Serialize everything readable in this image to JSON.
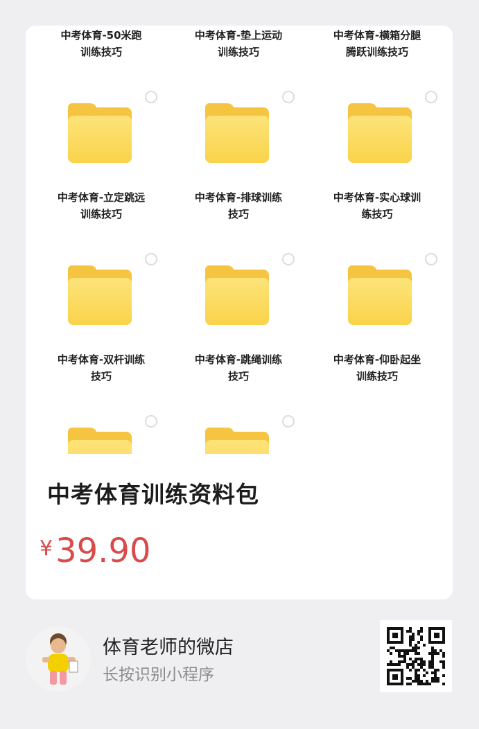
{
  "folders": [
    {
      "label_line1": "中考体育-50米跑",
      "label_line2": "训练技巧"
    },
    {
      "label_line1": "中考体育-垫上运动",
      "label_line2": "训练技巧"
    },
    {
      "label_line1": "中考体育-横箱分腿",
      "label_line2": "腾跃训练技巧"
    },
    {
      "label_line1": "中考体育-立定跳远",
      "label_line2": "训练技巧"
    },
    {
      "label_line1": "中考体育-排球训练",
      "label_line2": "技巧"
    },
    {
      "label_line1": "中考体育-实心球训",
      "label_line2": "练技巧"
    },
    {
      "label_line1": "中考体育-双杆训练",
      "label_line2": "技巧"
    },
    {
      "label_line1": "中考体育-跳绳训练",
      "label_line2": "技巧"
    },
    {
      "label_line1": "中考体育-仰卧起坐",
      "label_line2": "训练技巧"
    }
  ],
  "product": {
    "title": "中考体育训练资料包",
    "currency": "¥",
    "price": "39.90"
  },
  "shop": {
    "name": "体育老师的微店",
    "subtitle": "长按识别小程序"
  },
  "colors": {
    "price": "#d94b4b",
    "folder": "#f5c542",
    "background": "#efeff1"
  },
  "icons": {
    "folder": "folder-icon",
    "radio": "select-radio-icon",
    "qr": "qr-code-icon"
  }
}
